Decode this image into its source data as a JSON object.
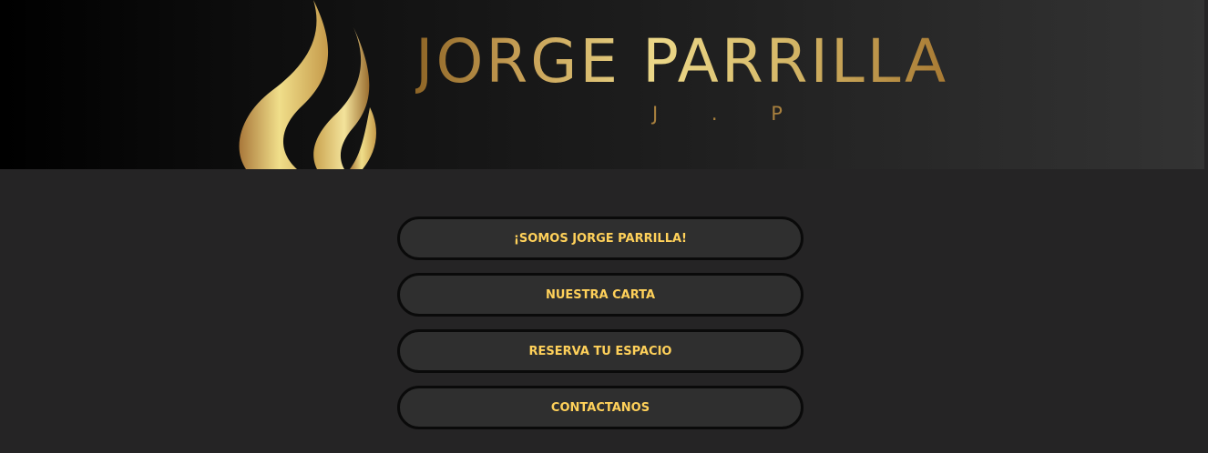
{
  "header": {
    "brand_title": "JORGE PARRILLA",
    "brand_subtitle": "J . P",
    "logo_icon": "flame-icon"
  },
  "nav": {
    "items": [
      {
        "label": "¡SOMOS JORGE PARRILLA!"
      },
      {
        "label": "NUESTRA CARTA"
      },
      {
        "label": "RESERVA TU ESPACIO"
      },
      {
        "label": "CONTACTANOS"
      }
    ]
  },
  "colors": {
    "page_background": "#252425",
    "button_background": "#2f2f2f",
    "button_border": "#0a0a0a",
    "button_text": "#ffd15a",
    "gold": "#d8bd6b"
  }
}
